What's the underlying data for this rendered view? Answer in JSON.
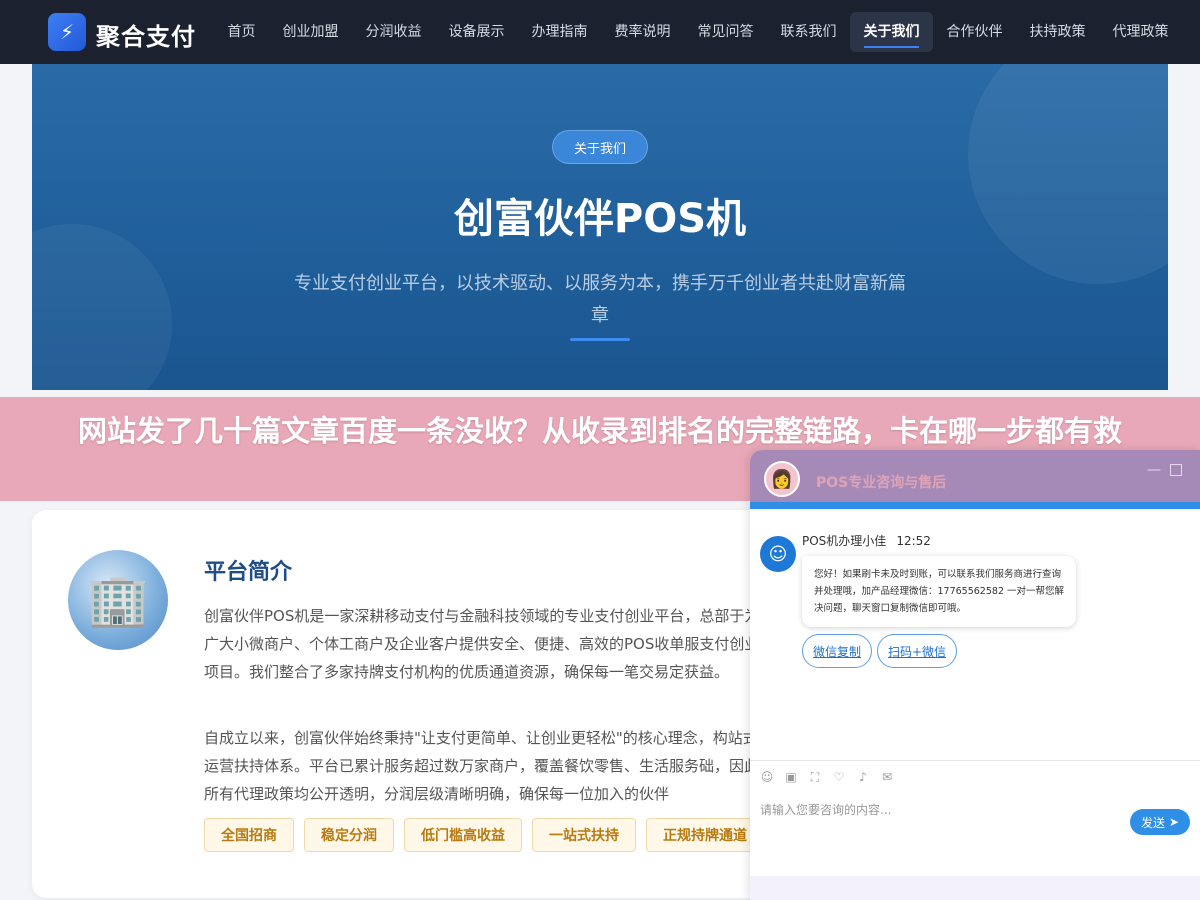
{
  "nav": {
    "logo_icon": "⚡",
    "logo_text": "聚合支付",
    "items": [
      {
        "label": "首页"
      },
      {
        "label": "创业加盟"
      },
      {
        "label": "分润收益"
      },
      {
        "label": "设备展示"
      },
      {
        "label": "办理指南"
      },
      {
        "label": "费率说明"
      },
      {
        "label": "常见问答"
      },
      {
        "label": "联系我们"
      },
      {
        "label": "关于我们",
        "active": true
      },
      {
        "label": "合作伙伴"
      },
      {
        "label": "扶持政策"
      },
      {
        "label": "代理政策"
      }
    ]
  },
  "hero": {
    "badge": "关于我们",
    "title": "创富伙伴POS机",
    "subtitle": "专业支付创业平台，以技术驱动、以服务为本，携手万千创业者共赴财富新篇章"
  },
  "banner": {
    "text": "网站发了几十篇文章百度一条没收？从收录到排名的完整链路，卡在哪一步都有救"
  },
  "intro": {
    "icon": "building-icon",
    "title": "平台简介",
    "paragraph1": "创富伙伴POS机是一家深耕移动支付与金融科技领域的专业支付创业平台，总部于为广大小微商户、个体工商户及企业客户提供安全、便捷、高效的POS收单服支付创业项目。我们整合了多家持牌支付机构的优质通道资源，确保每一笔交易定获益。",
    "paragraph2": "自成立以来，创富伙伴始终秉持\"让支付更简单、让创业更轻松\"的核心理念，构站式运营扶持体系。平台已累计服务超过数万家商户，覆盖餐饮零售、生活服务础，因此所有代理政策均公开透明，分润层级清晰明确，确保每一位加入的伙伴",
    "tags": [
      "全国招商",
      "稳定分润",
      "低门槛高收益",
      "一站式扶持",
      "正规持牌通道"
    ]
  },
  "chat": {
    "title": "POS专业咨询与售后",
    "agent_name": "POS机办理小佳",
    "time": "12:52",
    "message": "您好！如果刷卡未及时到账，可以联系我们服务商进行查询并处理哦，加产品经理微信：17765562582 一对一帮您解决问题，聊天窗口复制微信即可哦。",
    "button1": "微信复制",
    "button2": "扫码+微信",
    "input_placeholder": "请输入您要咨询的内容...",
    "send_label": "发送",
    "colors": {
      "header": "#a58ab8",
      "accent": "#2f8fe6"
    }
  }
}
